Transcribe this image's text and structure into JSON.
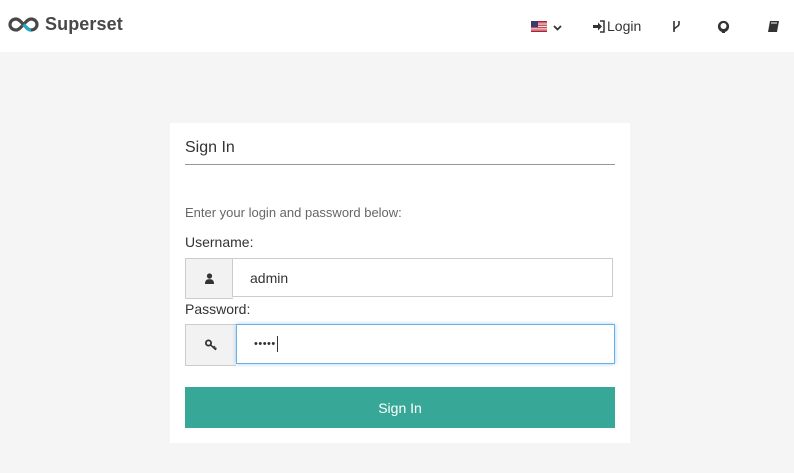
{
  "navbar": {
    "brand_name": "Superset",
    "language_icon": "us-flag-icon",
    "login_label": "Login",
    "icons": [
      "branch-icon",
      "github-icon",
      "book-icon"
    ]
  },
  "login_panel": {
    "title": "Sign In",
    "hint": "Enter your login and password below:",
    "username_label": "Username:",
    "username_value": "admin",
    "password_label": "Password:",
    "password_value": "•••••",
    "submit_label": "Sign In"
  },
  "colors": {
    "primary": "#37a897",
    "focus_border": "#66afe9",
    "page_bg": "#f5f5f5"
  }
}
